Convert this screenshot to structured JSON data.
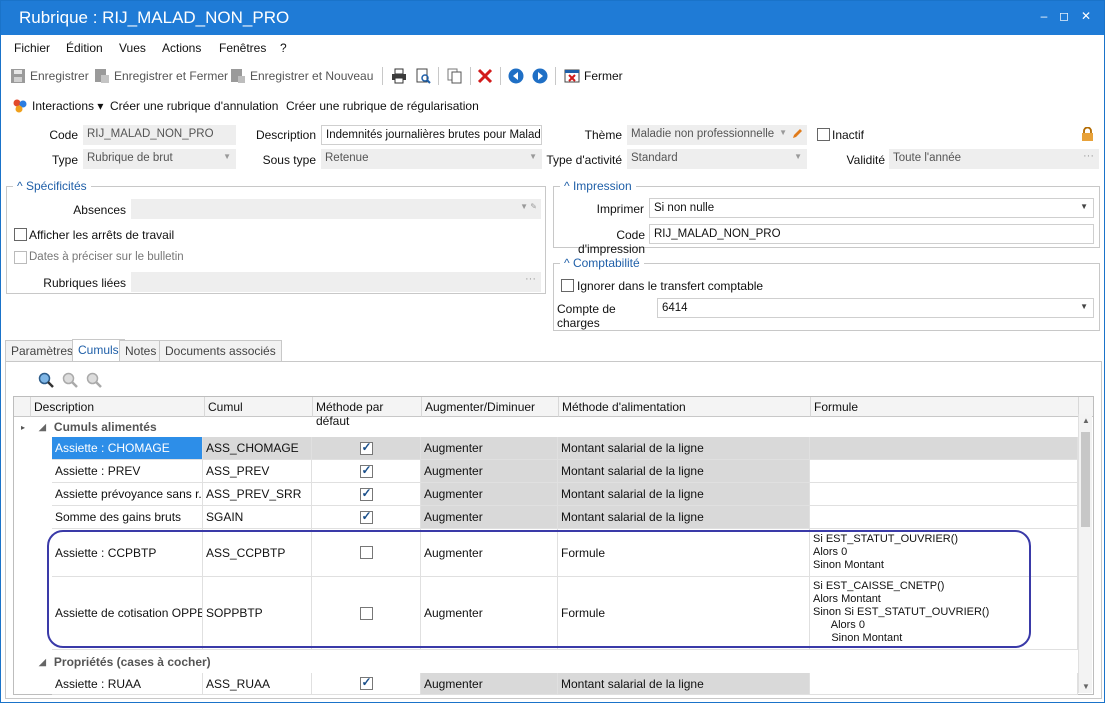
{
  "window": {
    "title": "Rubrique : RIJ_MALAD_NON_PRO",
    "min": "–",
    "max": "◻",
    "close": "✕"
  },
  "menu": [
    "Fichier",
    "Édition",
    "Vues",
    "Actions",
    "Fenêtres",
    "?"
  ],
  "toolbar": {
    "save": "Enregistrer",
    "save_close": "Enregistrer et Fermer",
    "save_new": "Enregistrer et Nouveau",
    "close": "Fermer"
  },
  "actions": {
    "interactions": "Interactions ▾",
    "annulation": "Créer une rubrique d'annulation",
    "regularisation": "Créer une rubrique de régularisation"
  },
  "form": {
    "code_label": "Code",
    "code_value": "RIJ_MALAD_NON_PRO",
    "description_label": "Description",
    "description_value": "Indemnités journalières brutes pour Maladie n",
    "theme_label": "Thème",
    "theme_value": "Maladie non professionnelle",
    "inactif_label": "Inactif",
    "type_label": "Type",
    "type_value": "Rubrique de brut",
    "soustype_label": "Sous type",
    "soustype_value": "Retenue",
    "activite_label": "Type d'activité",
    "activite_value": "Standard",
    "validite_label": "Validité",
    "validite_value": "Toute l'année"
  },
  "specificites": {
    "title": "Spécificités",
    "absences_label": "Absences",
    "arrets_label": "Afficher les arrêts de travail",
    "dates_label": "Dates à préciser sur le bulletin",
    "liees_label": "Rubriques liées"
  },
  "impression": {
    "title": "Impression",
    "imprimer_label": "Imprimer",
    "imprimer_value": "Si non nulle",
    "code_label": "Code d'impression",
    "code_value": "RIJ_MALAD_NON_PRO"
  },
  "comptabilite": {
    "title": "Comptabilité",
    "ignorer_label": "Ignorer dans le transfert comptable",
    "compte_label": "Compte de charges",
    "compte_value": "6414"
  },
  "tabs": [
    "Paramètres",
    "Cumuls",
    "Notes",
    "Documents associés"
  ],
  "grid": {
    "headers": [
      "Description",
      "Cumul",
      "Méthode par défaut",
      "Augmenter/Diminuer",
      "Méthode d'alimentation",
      "Formule"
    ],
    "group1": "Cumuls alimentés",
    "group2": "Propriétés (cases à cocher)",
    "rows": [
      {
        "desc": "Assiette : CHOMAGE",
        "cumul": "ASS_CHOMAGE",
        "checked": true,
        "aug": "Augmenter",
        "meth": "Montant salarial de la ligne",
        "formule": ""
      },
      {
        "desc": "Assiette : PREV",
        "cumul": "ASS_PREV",
        "checked": true,
        "aug": "Augmenter",
        "meth": "Montant salarial de la ligne",
        "formule": ""
      },
      {
        "desc": "Assiette prévoyance sans r...",
        "cumul": "ASS_PREV_SRR",
        "checked": true,
        "aug": "Augmenter",
        "meth": "Montant salarial de la ligne",
        "formule": ""
      },
      {
        "desc": "Somme des gains bruts",
        "cumul": "SGAIN",
        "checked": true,
        "aug": "Augmenter",
        "meth": "Montant salarial de la ligne",
        "formule": ""
      },
      {
        "desc": "Assiette : CCPBTP",
        "cumul": "ASS_CCPBTP",
        "checked": false,
        "aug": "Augmenter",
        "meth": "Formule",
        "formule": "Si EST_STATUT_OUVRIER()\nAlors 0\nSinon Montant"
      },
      {
        "desc": "Assiette de cotisation OPPBTP",
        "cumul": "SOPPBTP",
        "checked": false,
        "aug": "Augmenter",
        "meth": "Formule",
        "formule": "Si EST_CAISSE_CNETP()\nAlors Montant\nSinon Si EST_STATUT_OUVRIER()\n      Alors 0\n      Sinon Montant"
      },
      {
        "desc": "Assiette : RUAA",
        "cumul": "ASS_RUAA",
        "checked": true,
        "aug": "Augmenter",
        "meth": "Montant salarial de la ligne",
        "formule": ""
      }
    ]
  },
  "colors": {
    "titlebar": "#1f7bd6",
    "selection": "#2d8ee8",
    "highlight": "#3a3aa8"
  }
}
